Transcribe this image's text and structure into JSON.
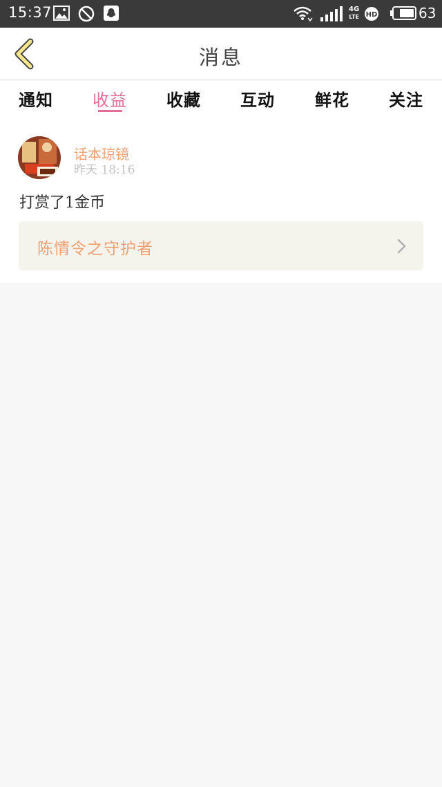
{
  "status_bar": {
    "time": "15:37",
    "network": "4G",
    "network_sub": "LTE",
    "battery_level": "63",
    "icons": [
      "gallery-icon",
      "block-icon",
      "qq-icon",
      "wifi-icon",
      "signal-icon",
      "hd-icon",
      "battery-icon"
    ]
  },
  "header": {
    "title": "消息",
    "back_icon": "chevron-left-icon"
  },
  "tabs": [
    {
      "label": "通知",
      "active": false
    },
    {
      "label": "收益",
      "active": true
    },
    {
      "label": "收藏",
      "active": false
    },
    {
      "label": "互动",
      "active": false
    },
    {
      "label": "鲜花",
      "active": false
    },
    {
      "label": "关注",
      "active": false
    }
  ],
  "messages": [
    {
      "sender": "话本琼镜",
      "time": "昨天  18:16",
      "text": "打赏了1金币",
      "link_label": "陈情令之守护者",
      "link_icon": "chevron-right-icon"
    }
  ],
  "colors": {
    "accent_pink": "#e0709a",
    "accent_orange": "#f0a070",
    "status_bar_bg": "#3a3a3a",
    "page_bg": "#f7f7f7",
    "link_box_bg": "#f4f3ec"
  }
}
